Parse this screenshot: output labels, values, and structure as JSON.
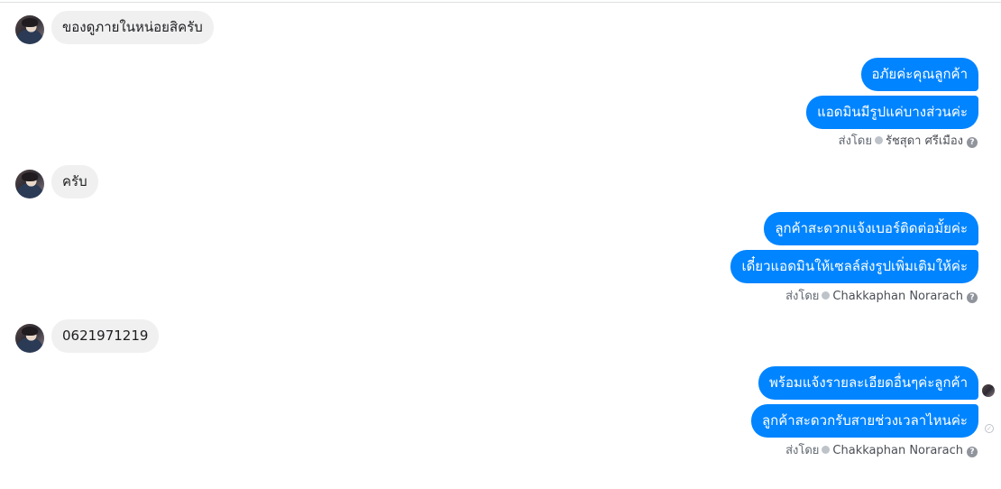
{
  "messages": [
    {
      "text": "ของดูภายในหน่อยสิครับ"
    },
    {
      "text": "อภัยค่ะคุณลูกค้า"
    },
    {
      "text": "แอดมินมีรูปแค่บางส่วนค่ะ"
    },
    {
      "text": "ครับ"
    },
    {
      "text": "ลูกค้าสะดวกแจ้งเบอร์ติดต่อมั้ยค่ะ"
    },
    {
      "text": "เดี๋ยวแอดมินให้เซลล์ส่งรูปเพิ่มเติมให้ค่ะ"
    },
    {
      "text": "0621971219"
    },
    {
      "text": "พร้อมแจ้งรายละเอียดอื่นๆค่ะลูกค้า"
    },
    {
      "text": "ลูกค้าสะดวกรับสายช่วงเวลาไหนค่ะ"
    }
  ],
  "sent_by": {
    "label": "ส่งโดย",
    "senders": [
      "รัชสุดา ศรีเมือง",
      "Chakkaphan Norarach",
      "Chakkaphan Norarach"
    ],
    "help_glyph": "?"
  },
  "icons": {
    "verified": "check-circle-icon",
    "help": "question-circle-icon",
    "delivered": "delivered-check-icon"
  },
  "colors": {
    "outgoing_bubble": "#0084ff",
    "incoming_bubble": "#f1f0f0",
    "text_dark": "#1c1e21"
  }
}
